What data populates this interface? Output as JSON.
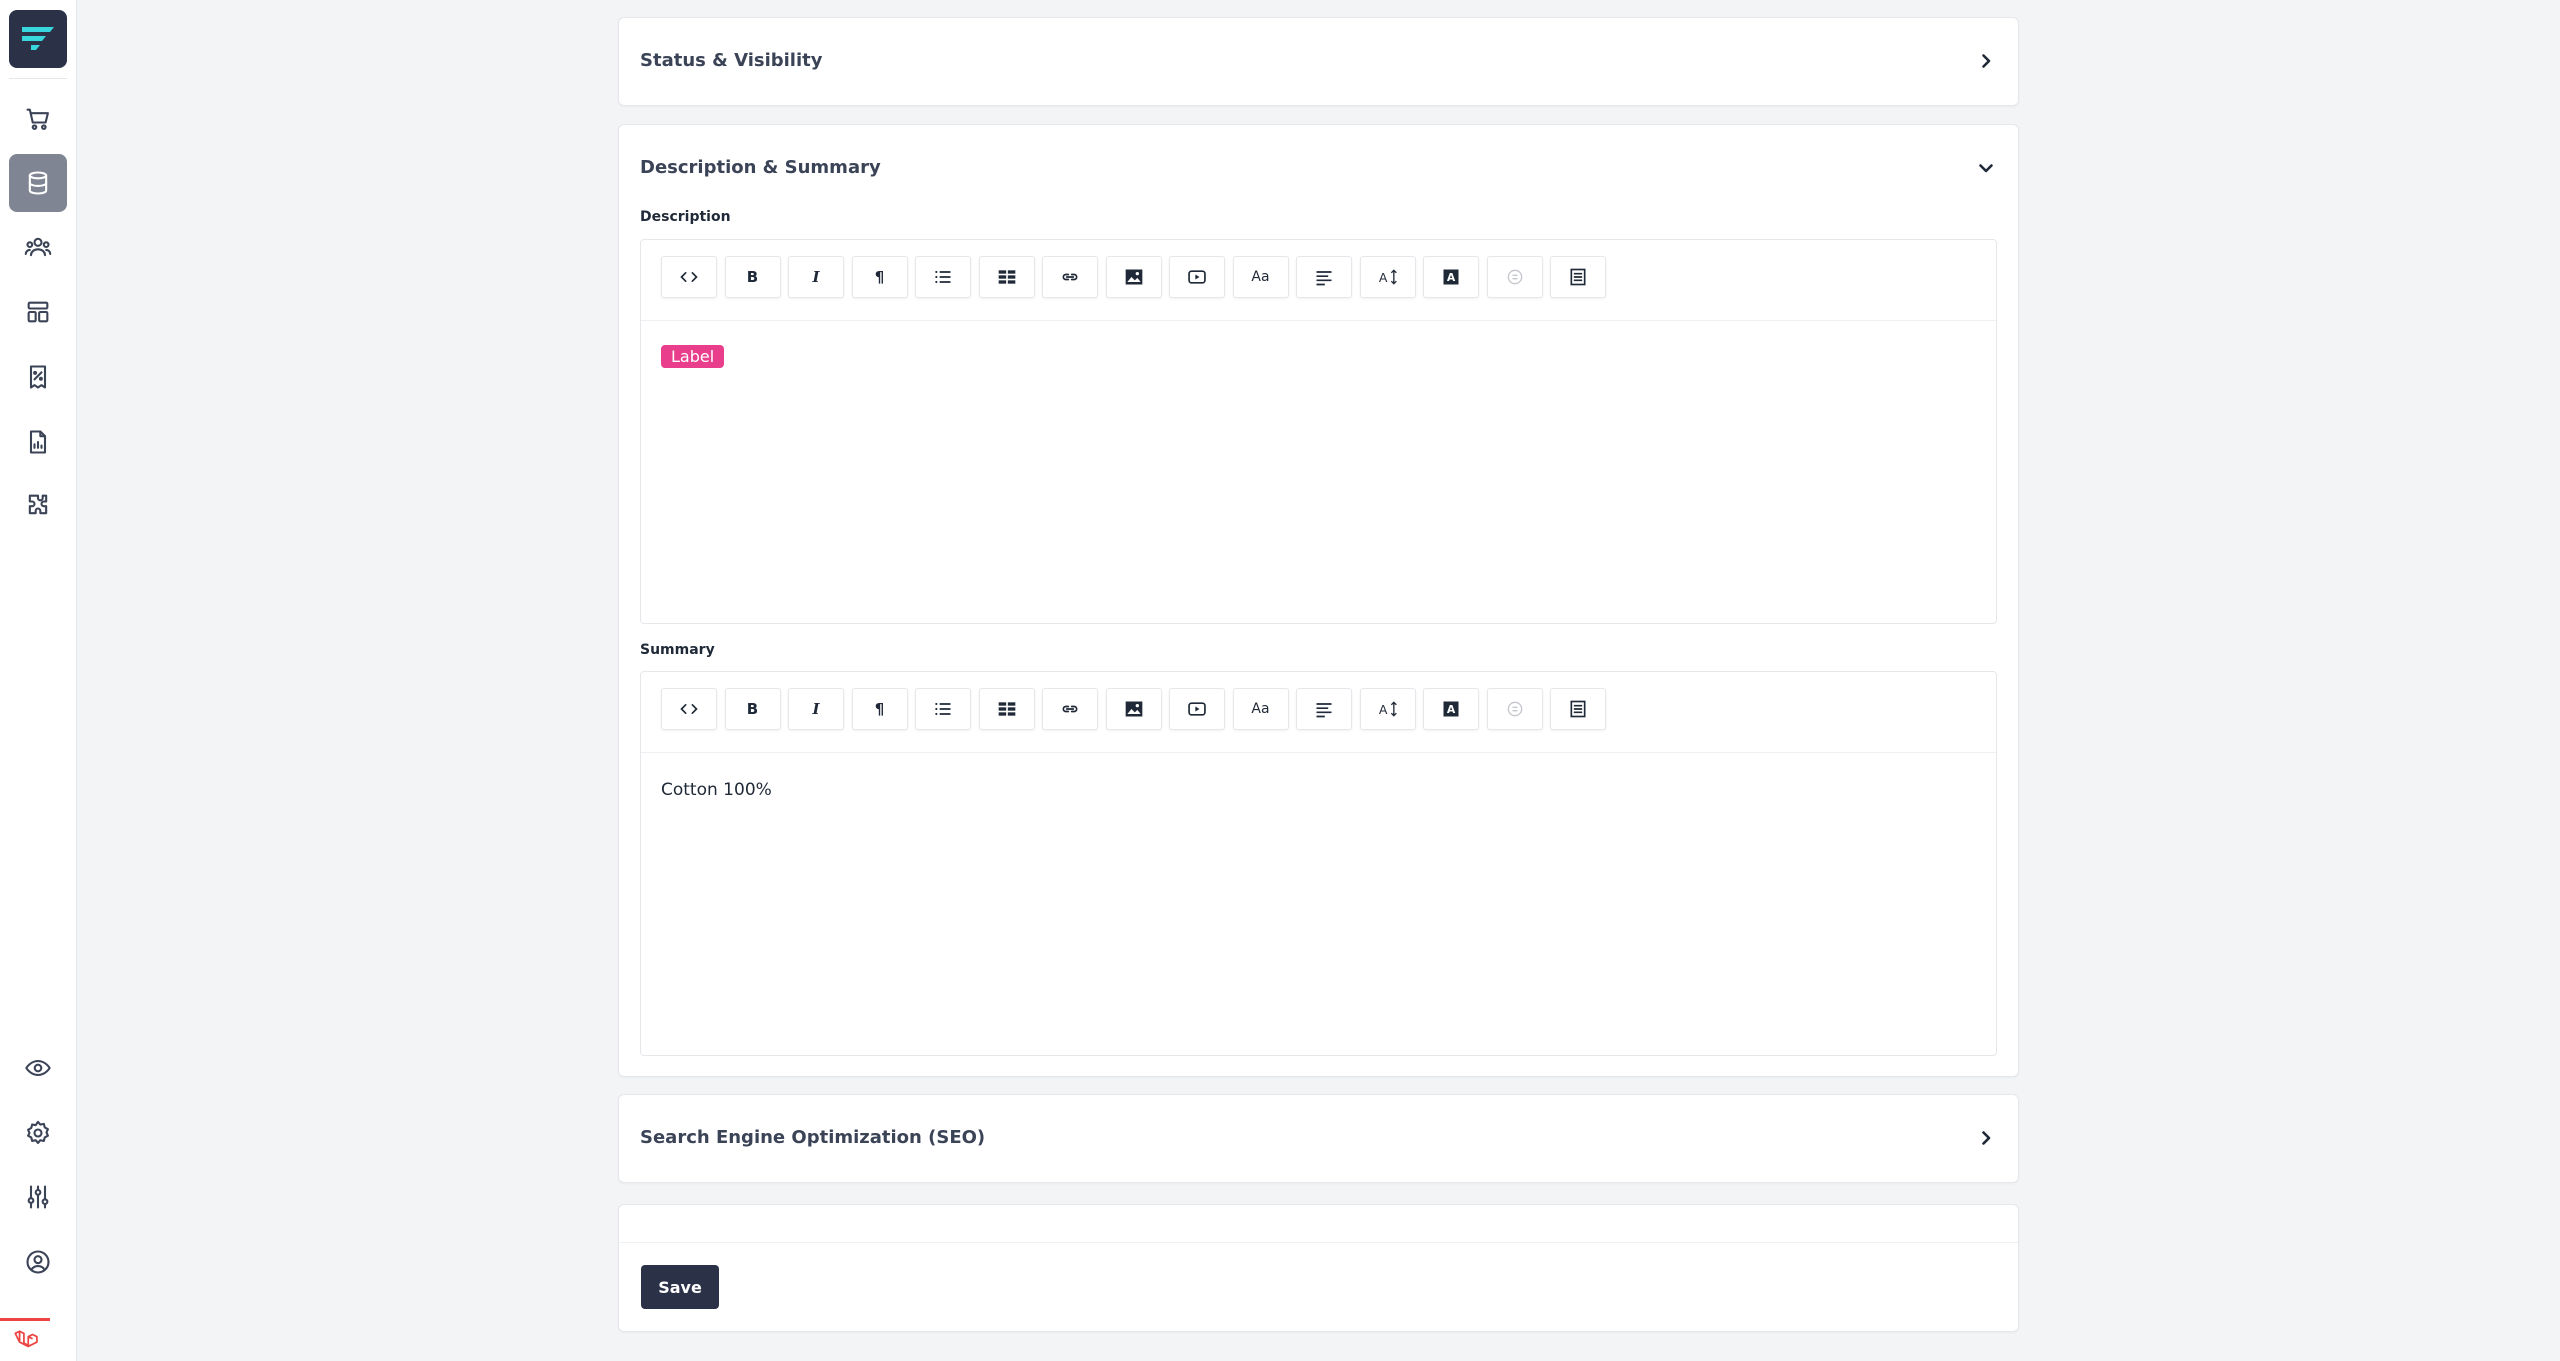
{
  "sidebar": {
    "top_items": [
      {
        "name": "orders",
        "icon": "shopping-cart-icon"
      },
      {
        "name": "products",
        "icon": "database-icon",
        "active": true
      },
      {
        "name": "customers",
        "icon": "users-icon"
      },
      {
        "name": "layout",
        "icon": "layout-icon"
      },
      {
        "name": "discounts",
        "icon": "receipt-percent-icon"
      },
      {
        "name": "reports",
        "icon": "report-chart-icon"
      },
      {
        "name": "extensions",
        "icon": "puzzle-icon"
      }
    ],
    "bottom_items": [
      {
        "name": "view-store",
        "icon": "eye-icon"
      },
      {
        "name": "settings",
        "icon": "gear-icon"
      },
      {
        "name": "adjustments",
        "icon": "sliders-icon"
      },
      {
        "name": "account",
        "icon": "user-circle-icon"
      }
    ]
  },
  "sections": {
    "status": {
      "title": "Status & Visibility"
    },
    "description_summary": {
      "title": "Description & Summary",
      "description_label": "Description",
      "summary_label": "Summary",
      "description_content": "Label",
      "summary_content": "Cotton 100%"
    },
    "seo": {
      "title": "Search Engine Optimization (SEO)"
    }
  },
  "toolbar": {
    "buttons": [
      {
        "name": "source-code",
        "icon": "code-icon"
      },
      {
        "name": "bold",
        "icon": "bold-icon",
        "text": "B"
      },
      {
        "name": "italic",
        "icon": "italic-icon",
        "text": "I"
      },
      {
        "name": "paragraph",
        "icon": "pilcrow-icon",
        "text": "¶"
      },
      {
        "name": "list",
        "icon": "list-icon"
      },
      {
        "name": "table",
        "icon": "table-icon"
      },
      {
        "name": "link",
        "icon": "link-icon"
      },
      {
        "name": "image",
        "icon": "image-icon"
      },
      {
        "name": "video",
        "icon": "video-icon"
      },
      {
        "name": "font-size",
        "icon": "font-size-icon",
        "text": "Aa"
      },
      {
        "name": "align",
        "icon": "align-left-icon"
      },
      {
        "name": "line-height",
        "icon": "line-height-icon"
      },
      {
        "name": "font-color",
        "icon": "font-color-icon"
      },
      {
        "name": "disabled-tool",
        "icon": "circle-disabled-icon"
      },
      {
        "name": "document",
        "icon": "document-icon"
      }
    ]
  },
  "footer": {
    "save_label": "Save"
  },
  "colors": {
    "primary": "#2b3248",
    "accent_cyan": "#38d6dd",
    "label_chip": "#e83e8c"
  }
}
